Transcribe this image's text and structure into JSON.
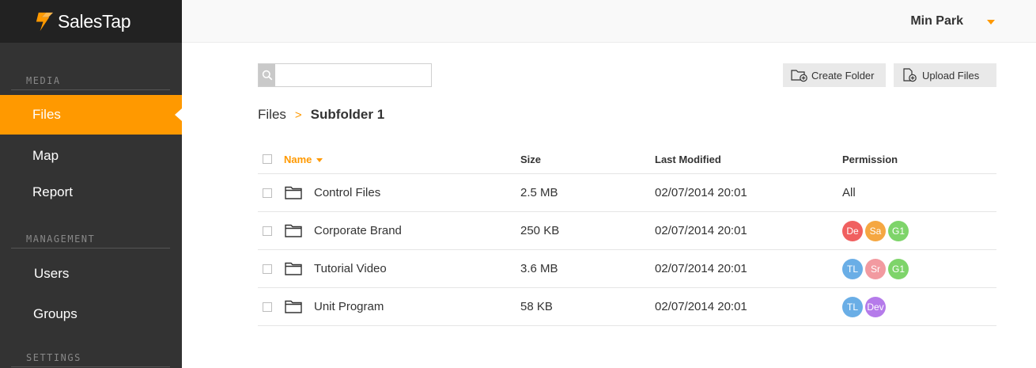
{
  "brand": {
    "name": "SalesTap",
    "accent": "#ff9900"
  },
  "sidebar": {
    "sections": {
      "media": "MEDIA",
      "management": "MANAGEMENT",
      "settings": "SETTINGS"
    },
    "items": [
      {
        "label": "Files",
        "active": true
      },
      {
        "label": "Map"
      },
      {
        "label": "Report"
      },
      {
        "label": "Users"
      },
      {
        "label": "Groups"
      }
    ]
  },
  "header": {
    "user_name": "Min Park"
  },
  "toolbar": {
    "search_placeholder": "",
    "create_folder_label": "Create Folder",
    "upload_files_label": "Upload Files"
  },
  "breadcrumb": {
    "root": "Files",
    "separator": ">",
    "current": "Subfolder 1"
  },
  "table": {
    "columns": {
      "name": "Name",
      "size": "Size",
      "modified": "Last Modified",
      "permission": "Permission"
    },
    "rows": [
      {
        "name": "Control Files",
        "size": "2.5 MB",
        "modified": "02/07/2014 20:01",
        "permission_text": "All",
        "avatars": []
      },
      {
        "name": "Corporate Brand",
        "size": "250 KB",
        "modified": "02/07/2014 20:01",
        "permission_text": "",
        "avatars": [
          {
            "label": "De",
            "color": "#f06060"
          },
          {
            "label": "Sa",
            "color": "#f5a742"
          },
          {
            "label": "G1",
            "color": "#7ed46a"
          }
        ]
      },
      {
        "name": "Tutorial Video",
        "size": "3.6 MB",
        "modified": "02/07/2014 20:01",
        "permission_text": "",
        "avatars": [
          {
            "label": "TL",
            "color": "#6aaee6"
          },
          {
            "label": "Sr",
            "color": "#f29aa0"
          },
          {
            "label": "G1",
            "color": "#7ed46a"
          }
        ]
      },
      {
        "name": "Unit Program",
        "size": "58 KB",
        "modified": "02/07/2014 20:01",
        "permission_text": "",
        "avatars": [
          {
            "label": "TL",
            "color": "#6aaee6"
          },
          {
            "label": "Dev",
            "color": "#b57bea"
          }
        ]
      }
    ]
  }
}
